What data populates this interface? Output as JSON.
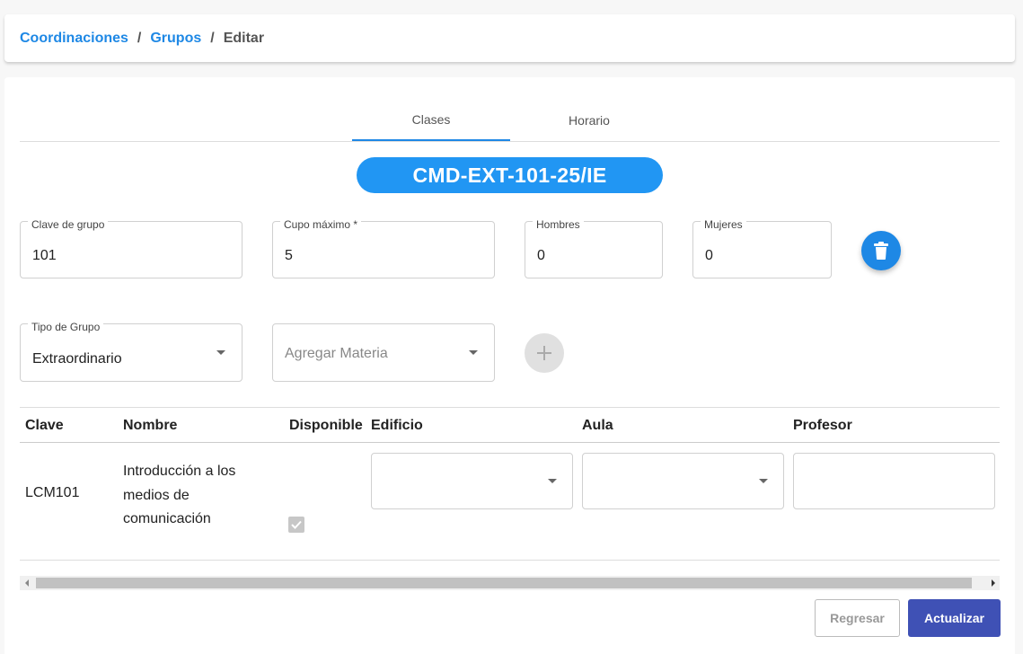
{
  "breadcrumb": {
    "items": [
      {
        "label": "Coordinaciones"
      },
      {
        "label": "Grupos"
      }
    ],
    "separator": "/",
    "current": "Editar"
  },
  "tabs": [
    {
      "label": "Clases",
      "active": true
    },
    {
      "label": "Horario",
      "active": false
    }
  ],
  "group_code": "CMD-EXT-101-25/IE",
  "fields": {
    "clave": {
      "label": "Clave de grupo",
      "value": "101"
    },
    "cupo": {
      "label": "Cupo máximo *",
      "value": "5"
    },
    "hombres": {
      "label": "Hombres",
      "value": "0"
    },
    "mujeres": {
      "label": "Mujeres",
      "value": "0"
    },
    "tipo": {
      "label": "Tipo de Grupo",
      "value": "Extraordinario"
    },
    "materia": {
      "placeholder": "Agregar Materia"
    }
  },
  "table": {
    "headers": [
      "Clave",
      "Nombre",
      "Disponible",
      "Edificio",
      "Aula",
      "Profesor"
    ],
    "rows": [
      {
        "clave": "LCM101",
        "nombre_lines": [
          "Introducción a los",
          "medios de",
          "comunicación"
        ],
        "disponible": true,
        "edificio": "",
        "aula": "",
        "profesor": ""
      }
    ]
  },
  "buttons": {
    "back": "Regresar",
    "update": "Actualizar"
  },
  "colors": {
    "accent": "#2196f3",
    "link": "#1e88e5",
    "primary_button": "#3f51b5"
  }
}
